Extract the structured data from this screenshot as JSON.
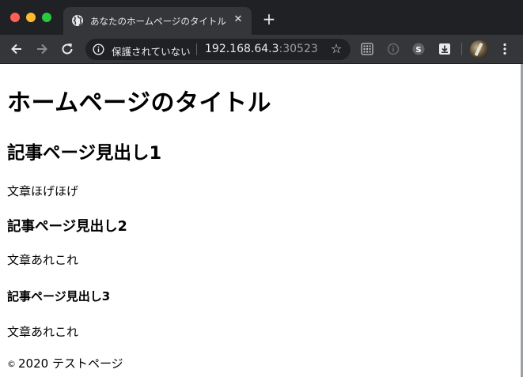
{
  "tab": {
    "title": "あなたのホームページのタイトル",
    "close_glyph": "✕",
    "new_tab_glyph": "+"
  },
  "omnibox": {
    "security_label": "保護されていない",
    "url_host": "192.168.64.3",
    "url_port": ":30523",
    "star_glyph": "☆"
  },
  "page": {
    "h1": "ホームページのタイトル",
    "h2": "記事ページ見出し1",
    "p1": "文章ほげほげ",
    "h3a": "記事ページ見出し2",
    "p2": "文章あれこれ",
    "h3b": "記事ページ見出し3",
    "p3": "文章あれこれ",
    "footer_copy": "©",
    "footer_text": "2020 テストページ"
  },
  "icons": {
    "traffic_lights": [
      "close",
      "minimize",
      "zoom"
    ],
    "toolbar": [
      "back-arrow",
      "forward-arrow",
      "reload",
      "info",
      "star",
      "grid-extension",
      "info-extension",
      "s-extension",
      "download-extension",
      "avatar",
      "menu-dots"
    ]
  },
  "colors": {
    "tabstrip": "#202124",
    "toolbar": "#35363a",
    "omnibox": "#202124",
    "traffic_red": "#ff5f57",
    "traffic_yellow": "#febc2e",
    "traffic_green": "#28c840"
  }
}
